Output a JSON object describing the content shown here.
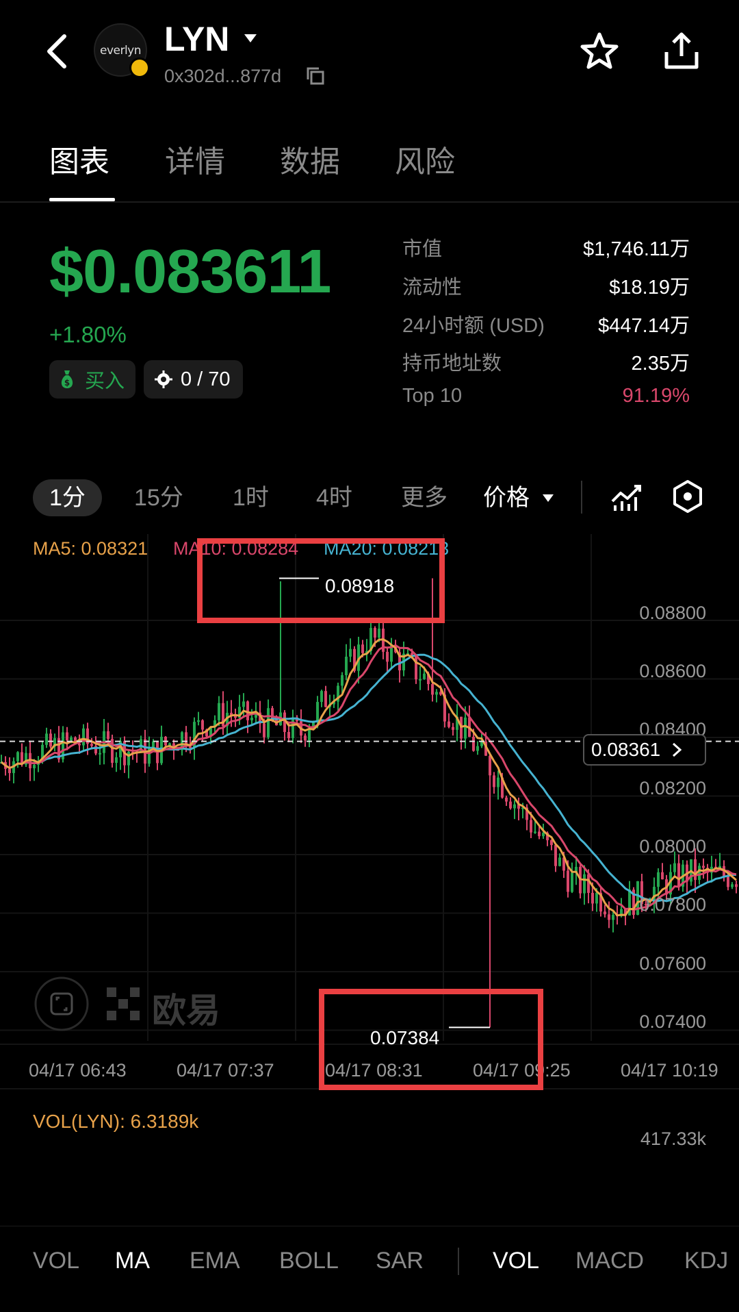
{
  "header": {
    "token_name": "LYN",
    "address": "0x302d...877d",
    "logo_text": "everlyn",
    "icons": [
      "back-icon",
      "caret-down-icon",
      "copy-icon",
      "star-icon",
      "share-icon"
    ]
  },
  "tabs": [
    {
      "label": "图表",
      "active": true
    },
    {
      "label": "详情",
      "active": false
    },
    {
      "label": "数据",
      "active": false
    },
    {
      "label": "风险",
      "active": false
    }
  ],
  "price": {
    "value": "$0.083611",
    "change": "+1.80%",
    "buy_label": "买入",
    "holders_count": "0 / 70"
  },
  "stats": [
    {
      "label": "市值",
      "value": "$1,746.11万"
    },
    {
      "label": "流动性",
      "value": "$18.19万"
    },
    {
      "label": "24小时额 (USD)",
      "value": "$447.14万"
    },
    {
      "label": "持币地址数",
      "value": "2.35万"
    },
    {
      "label": "Top 10",
      "value": "91.19%"
    }
  ],
  "intervals": {
    "items": [
      "1分",
      "15分",
      "1时",
      "4时",
      "更多"
    ],
    "active": "1分",
    "price_dropdown": "价格"
  },
  "chart": {
    "ma_legend": {
      "ma5": "MA5: 0.08321",
      "ma10": "MA10: 0.08284",
      "ma20": "MA20: 0.08213"
    },
    "high_label": "0.08918",
    "low_label": "0.07384",
    "current_price": "0.08361",
    "y_ticks": [
      "0.08800",
      "0.08600",
      "0.08400",
      "0.08200",
      "0.08000",
      "0.07800",
      "0.07600",
      "0.07400"
    ],
    "x_ticks": [
      "04/17 06:43",
      "04/17 07:37",
      "04/17 08:31",
      "04/17 09:25",
      "04/17 10:19"
    ],
    "watermark": "欧易",
    "colors": {
      "up": "#25a750",
      "down": "#d9476b",
      "ma5": "#e8a24a",
      "ma10": "#d9476b",
      "ma20": "#46b3d1",
      "highlight": "#ea4042"
    }
  },
  "chart_data": {
    "type": "line",
    "title": "",
    "xlabel": "",
    "ylabel": "",
    "ylim": [
      0.0732,
      0.0898
    ],
    "x": [
      "04/17 06:43",
      "04/17 07:37",
      "04/17 08:31",
      "04/17 09:25",
      "04/17 10:19"
    ],
    "series": [
      {
        "name": "MA5",
        "values": [
          0.0834,
          0.0846,
          0.0855,
          0.0826,
          0.0791
        ]
      },
      {
        "name": "MA10",
        "values": [
          0.0833,
          0.0844,
          0.0852,
          0.0829,
          0.0792
        ]
      },
      {
        "name": "MA20",
        "values": [
          0.0832,
          0.0842,
          0.0847,
          0.0833,
          0.0793
        ]
      }
    ],
    "high": 0.08918,
    "low": 0.07384,
    "last": 0.08361,
    "grid": true
  },
  "volume": {
    "label": "VOL(LYN): 6.3189k",
    "max": "417.33k"
  },
  "indicator_tabs": {
    "main": [
      {
        "label": "VOL",
        "active": false
      },
      {
        "label": "MA",
        "active": true
      },
      {
        "label": "EMA",
        "active": false
      },
      {
        "label": "BOLL",
        "active": false
      },
      {
        "label": "SAR",
        "active": false
      }
    ],
    "sub": [
      {
        "label": "VOL",
        "active": true
      },
      {
        "label": "MACD",
        "active": false
      },
      {
        "label": "KDJ",
        "active": false
      }
    ]
  }
}
